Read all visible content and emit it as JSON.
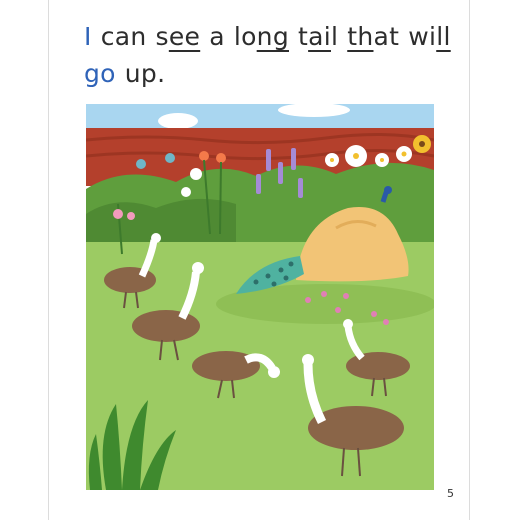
{
  "sentence": {
    "line1": [
      {
        "parts": [
          {
            "t": "I",
            "c": "blue"
          }
        ]
      },
      {
        "parts": [
          {
            "t": "can"
          }
        ]
      },
      {
        "parts": [
          {
            "t": "s"
          },
          {
            "t": "ee",
            "u": true
          }
        ]
      },
      {
        "parts": [
          {
            "t": "a"
          }
        ]
      },
      {
        "parts": [
          {
            "t": "lo"
          },
          {
            "t": "ng",
            "u": true
          }
        ]
      },
      {
        "parts": [
          {
            "t": "t"
          },
          {
            "t": "ai",
            "u": true
          },
          {
            "t": "l"
          }
        ]
      },
      {
        "parts": [
          {
            "t": "th",
            "u": true
          },
          {
            "t": "at"
          }
        ]
      },
      {
        "parts": [
          {
            "t": "wi"
          },
          {
            "t": "ll",
            "u": true
          }
        ]
      }
    ],
    "line2": [
      {
        "parts": [
          {
            "t": "go",
            "c": "blue"
          }
        ]
      },
      {
        "parts": [
          {
            "t": "up"
          },
          {
            "t": "."
          }
        ]
      }
    ]
  },
  "page_number": "5",
  "colors": {
    "sky": "#a9d6f0",
    "wall": "#b4402c",
    "grass": "#9ccb63",
    "rock": "#f2c476",
    "blue_word": "#2f63b8"
  },
  "illustration": {
    "subject": "peahens in a garden with peacock behind a rock",
    "peahen_count": 6
  }
}
